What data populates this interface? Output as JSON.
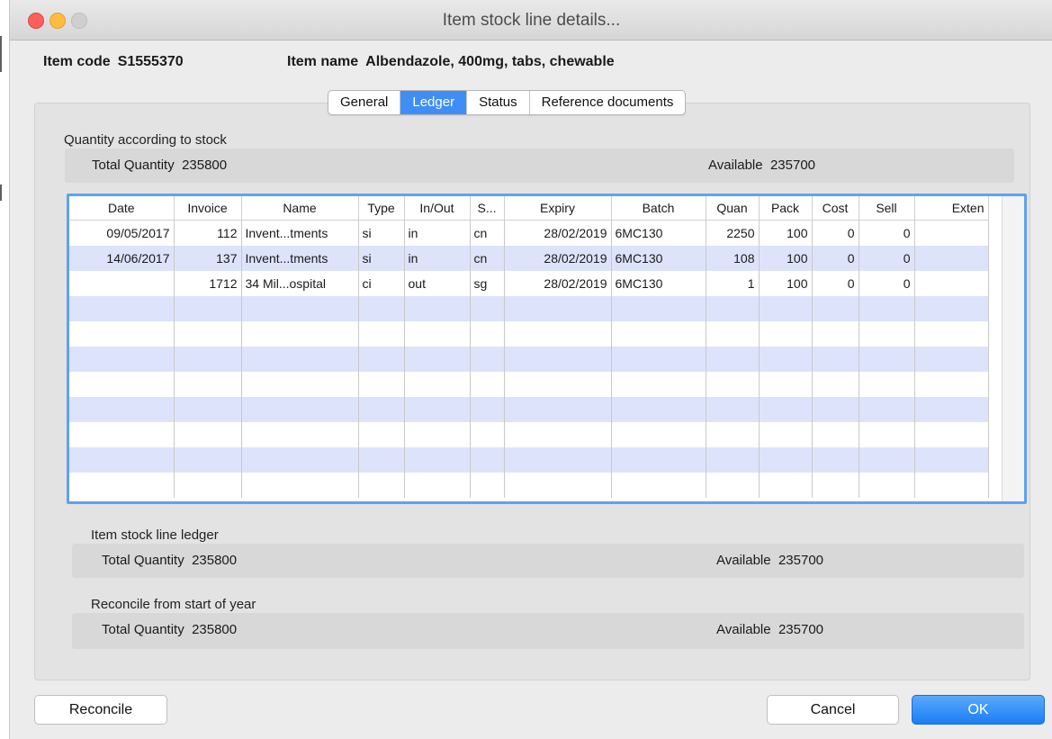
{
  "window": {
    "title": "Item stock line details..."
  },
  "header": {
    "item_code_label": "Item code",
    "item_code": "S1555370",
    "item_name_label": "Item name",
    "item_name": "Albendazole, 400mg, tabs, chewable"
  },
  "tabs": [
    {
      "label": "General"
    },
    {
      "label": "Ledger"
    },
    {
      "label": "Status"
    },
    {
      "label": "Reference documents"
    }
  ],
  "stock_section": {
    "title": "Quantity according to stock",
    "total_label": "Total Quantity",
    "total_value": "235800",
    "available_label": "Available",
    "available_value": "235700"
  },
  "table": {
    "columns": [
      "Date",
      "Invoice",
      "Name",
      "Type",
      "In/Out",
      "S...",
      "Expiry",
      "Batch",
      "Quan",
      "Pack",
      "Cost",
      "Sell",
      "Exten"
    ],
    "rows": [
      [
        "09/05/2017",
        "112",
        "Invent...tments",
        "si",
        "in",
        "cn",
        "28/02/2019",
        "6MC130",
        "2250",
        "100",
        "0",
        "0",
        ""
      ],
      [
        "14/06/2017",
        "137",
        "Invent...tments",
        "si",
        "in",
        "cn",
        "28/02/2019",
        "6MC130",
        "108",
        "100",
        "0",
        "0",
        ""
      ],
      [
        "",
        "1712",
        "34 Mil...ospital",
        "ci",
        "out",
        "sg",
        "28/02/2019",
        "6MC130",
        "1",
        "100",
        "0",
        "0",
        ""
      ]
    ]
  },
  "ledger_section": {
    "title": "Item stock line ledger",
    "total_label": "Total Quantity",
    "total_value": "235800",
    "available_label": "Available",
    "available_value": "235700"
  },
  "reconcile_section": {
    "title": "Reconcile from start of year",
    "total_label": "Total Quantity",
    "total_value": "235800",
    "available_label": "Available",
    "available_value": "235700"
  },
  "buttons": {
    "reconcile": "Reconcile",
    "cancel": "Cancel",
    "ok": "OK"
  },
  "colors": {
    "accent": "#3f8ef6",
    "row_stripe": "#dde3fb",
    "table_focus_border": "#5ea2f0"
  }
}
